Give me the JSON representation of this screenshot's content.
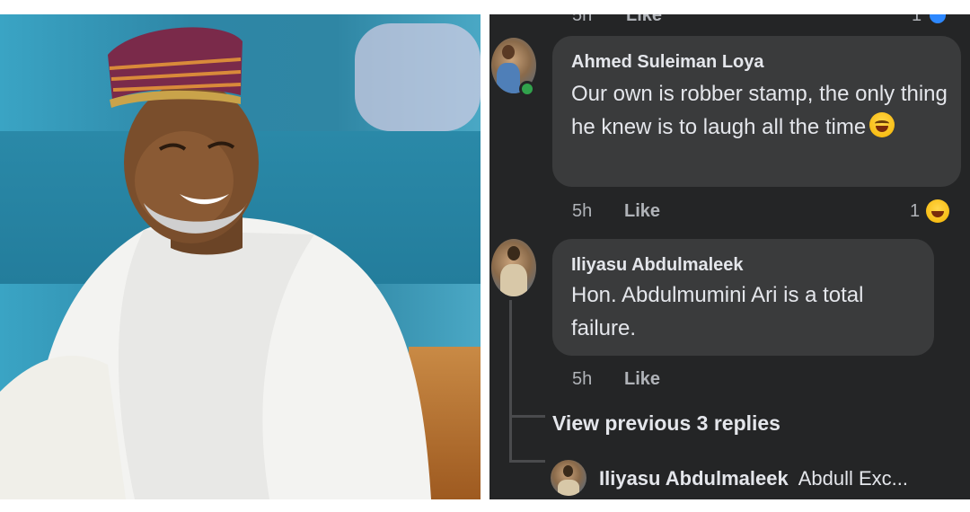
{
  "comments": [
    {
      "author": "Ahmed Suleiman Loya",
      "text": "Our own is robber stamp, the only thing he knew is to laugh all the time",
      "time": "5h",
      "like_label": "Like",
      "reaction_count": "1"
    },
    {
      "author": "Iliyasu Abdulmaleek",
      "text": "Hon. Abdulmumini Ari is a total failure.",
      "time": "5h",
      "like_label": "Like"
    }
  ],
  "view_previous": "View previous 3 replies",
  "reply": {
    "author": "Iliyasu Abdulmaleek",
    "preview": "Abdull Exc..."
  },
  "top_cut": {
    "time": "5h",
    "like_label": "Like",
    "reaction_count": "1"
  }
}
